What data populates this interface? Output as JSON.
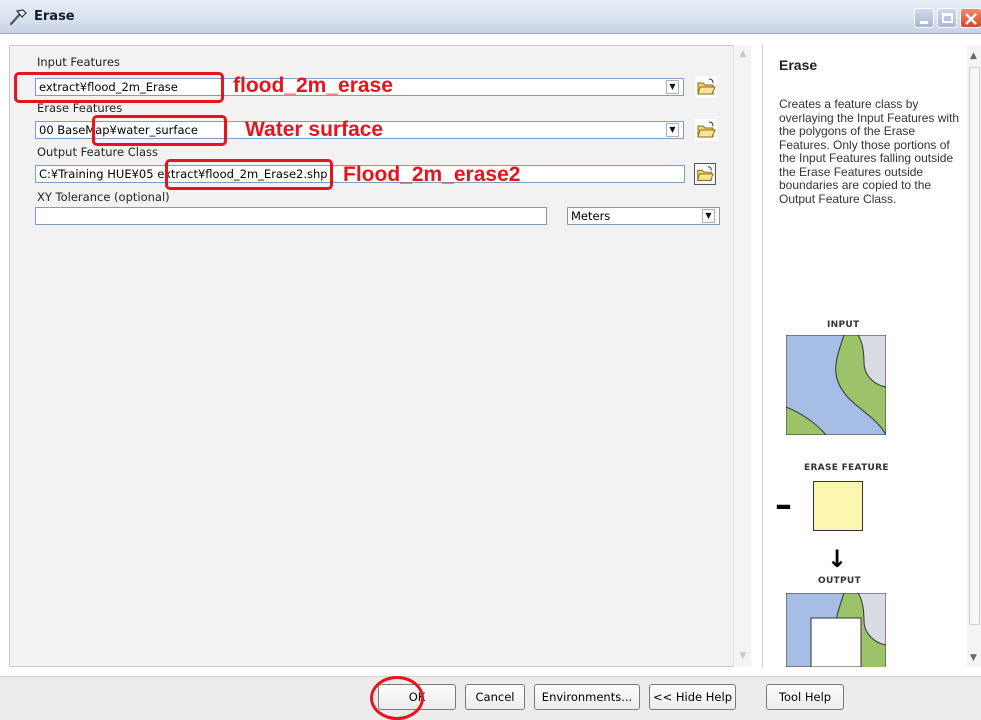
{
  "window": {
    "title": "Erase"
  },
  "form": {
    "input_features": {
      "label": "Input Features",
      "value": "extract¥flood_2m_Erase"
    },
    "erase_features": {
      "label": "Erase Features",
      "value": "00 BaseMap¥water_surface"
    },
    "output_feature_class": {
      "label": "Output Feature Class",
      "value": "C:¥Training HUE¥05 extract¥flood_2m_Erase2.shp"
    },
    "xy_tolerance": {
      "label": "XY Tolerance (optional)",
      "value": "",
      "unit": "Meters"
    }
  },
  "annotations": {
    "input_note": "flood_2m_erase",
    "erase_note": "Water surface",
    "output_note": "Flood_2m_erase2"
  },
  "help": {
    "title": "Erase",
    "description": "Creates a feature class by overlaying the Input Features with the polygons of the Erase Features. Only those portions of the Input Features falling outside the Erase Features outside boundaries are copied to the Output Feature Class.",
    "input_caption": "INPUT",
    "erase_caption": "ERASE FEATURE",
    "output_caption": "OUTPUT",
    "minus_symbol": "–",
    "arrow_symbol": "↓"
  },
  "buttons": {
    "ok": "OK",
    "cancel": "Cancel",
    "environments": "Environments...",
    "hide_help": "<< Hide Help",
    "tool_help": "Tool Help"
  },
  "colors": {
    "annotation_red": "#e8141c",
    "map_blue": "#a6bde6",
    "map_green": "#9cc26a",
    "map_gray": "#d8dde3",
    "erase_yellow": "#fbf6b0"
  },
  "icons": {
    "title": "hammer-icon",
    "browse": "open-folder-icon",
    "dropdown": "chevron-down-icon"
  }
}
